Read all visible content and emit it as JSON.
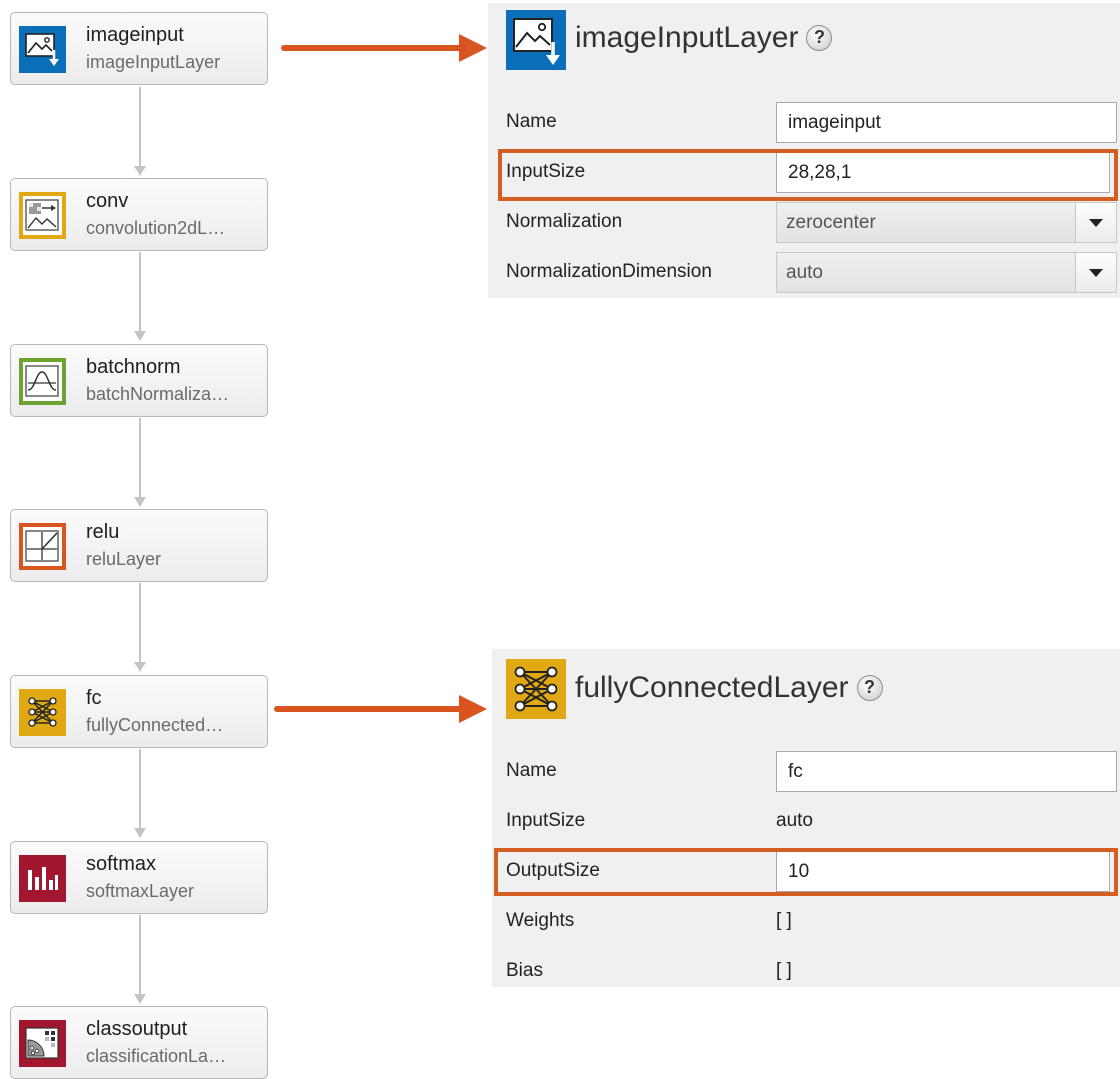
{
  "layers": [
    {
      "name": "imageinput",
      "type": "imageInputLayer",
      "icon": "image-input-icon",
      "color": "#0b6eb8"
    },
    {
      "name": "conv",
      "type": "convolution2dL…",
      "icon": "convolution-icon",
      "color": "#e0a914"
    },
    {
      "name": "batchnorm",
      "type": "batchNormaliza…",
      "icon": "batch-normalization-icon",
      "color": "#6ba430"
    },
    {
      "name": "relu",
      "type": "reluLayer",
      "icon": "relu-icon",
      "color": "#d9541e"
    },
    {
      "name": "fc",
      "type": "fullyConnected…",
      "icon": "fully-connected-icon",
      "color": "#e0a914"
    },
    {
      "name": "softmax",
      "type": "softmaxLayer",
      "icon": "softmax-icon",
      "color": "#a21630"
    },
    {
      "name": "classoutput",
      "type": "classificationLa…",
      "icon": "classification-output-icon",
      "color": "#a21630"
    }
  ],
  "image_input_panel": {
    "title": "imageInputLayer",
    "help": "?",
    "properties": {
      "name": {
        "label": "Name",
        "value": "imageinput"
      },
      "input_size": {
        "label": "InputSize",
        "value": "28,28,1"
      },
      "normalization": {
        "label": "Normalization",
        "value": "zerocenter"
      },
      "normalization_dimension": {
        "label": "NormalizationDimension",
        "value": "auto"
      }
    }
  },
  "fully_connected_panel": {
    "title": "fullyConnectedLayer",
    "help": "?",
    "properties": {
      "name": {
        "label": "Name",
        "value": "fc"
      },
      "input_size": {
        "label": "InputSize",
        "value": "auto"
      },
      "output_size": {
        "label": "OutputSize",
        "value": "10"
      },
      "weights": {
        "label": "Weights",
        "value": "[ ]"
      },
      "bias": {
        "label": "Bias",
        "value": "[ ]"
      }
    }
  },
  "colors": {
    "highlight": "#d55d22",
    "pointer_arrow": "#d9541e",
    "connector": "#c4c4c4",
    "panel_background": "#f0f0f0"
  }
}
